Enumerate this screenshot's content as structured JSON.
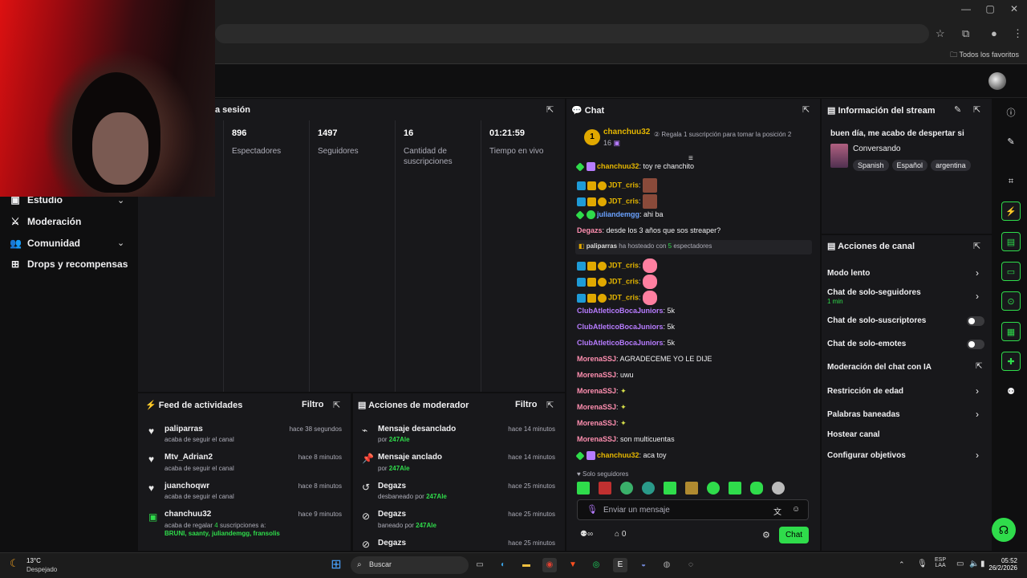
{
  "browser": {
    "bookmarks_label": "Todos los favoritos"
  },
  "leftnav": {
    "session_label": "a sesión",
    "items": [
      {
        "label": "Estudio",
        "icon": "video-icon",
        "has_chevron": true
      },
      {
        "label": "Moderación",
        "icon": "sword-icon",
        "has_chevron": false
      },
      {
        "label": "Comunidad",
        "icon": "people-icon",
        "has_chevron": true
      },
      {
        "label": "Drops y recompensas",
        "icon": "gift-icon",
        "has_chevron": false
      }
    ]
  },
  "stats": [
    {
      "value": "896",
      "label": "Espectadores"
    },
    {
      "value": "1497",
      "label": "Seguidores"
    },
    {
      "value": "16",
      "label": "Cantidad de suscripciones"
    },
    {
      "value": "01:21:59",
      "label": "Tiempo en vivo"
    }
  ],
  "feed": {
    "title": "Feed de actividades",
    "filter": "Filtro",
    "rows": [
      {
        "name": "paliparras",
        "sub": "acaba de seguir el canal",
        "time": "hace 38 segundos"
      },
      {
        "name": "Mtv_Adrian2",
        "sub": "acaba de seguir el canal",
        "time": "hace 8 minutos"
      },
      {
        "name": "juanchoqwr",
        "sub": "acaba de seguir el canal",
        "time": "hace 8 minutos"
      },
      {
        "name": "chanchuu32",
        "sub_a": "acaba de regalar ",
        "sub_n": "4",
        "sub_b": " suscripciones a:",
        "sub_list": "BRUNI, saanty, juliandemgg, fransolis",
        "time": "hace 9 minutos"
      }
    ]
  },
  "modact": {
    "title": "Acciones de moderador",
    "filter": "Filtro",
    "rows": [
      {
        "name": "Mensaje desanclado",
        "pre": "por ",
        "by": "247Ale",
        "time": "hace 14 minutos"
      },
      {
        "name": "Mensaje anclado",
        "pre": "por ",
        "by": "247Ale",
        "time": "hace 14 minutos"
      },
      {
        "name": "Degazs",
        "pre": "desbaneado por ",
        "by": "247Ale",
        "time": "hace 25 minutos"
      },
      {
        "name": "Degazs",
        "pre": "baneado por ",
        "by": "247Ale",
        "time": "hace 25 minutos"
      },
      {
        "name": "Degazs",
        "pre": "",
        "by": "",
        "time": "hace 25 minutos"
      }
    ]
  },
  "chat": {
    "title": "Chat",
    "top_gifter": {
      "rank": "1",
      "name": "chanchuu32",
      "count": "16"
    },
    "gift_prompt": "Regala 1 suscripción para tomar la posición 2",
    "messages": [
      {
        "user": "chanchuu32",
        "text": ": toy re chanchito"
      },
      {
        "user": "JDT_cris",
        "text": ":"
      },
      {
        "user": "JDT_cris",
        "text": ":"
      },
      {
        "user": "juliandemgg",
        "text": ": ahi ba"
      },
      {
        "user": "Degazs",
        "text": ": desde los 3 años que sos streaper?"
      },
      {
        "user": "JDT_cris",
        "text": ":"
      },
      {
        "user": "JDT_cris",
        "text": ":"
      },
      {
        "user": "JDT_cris",
        "text": ":"
      },
      {
        "user": "ClubAtleticoBocaJuniors",
        "text": ": 5k"
      },
      {
        "user": "ClubAtleticoBocaJuniors",
        "text": ": 5k"
      },
      {
        "user": "ClubAtleticoBocaJuniors",
        "text": ": 5k"
      },
      {
        "user": "MorenaSSJ",
        "text": ": AGRADECEME YO LE DIJE"
      },
      {
        "user": "MorenaSSJ",
        "text": ": uwu"
      },
      {
        "user": "MorenaSSJ",
        "text": ":"
      },
      {
        "user": "MorenaSSJ",
        "text": ":"
      },
      {
        "user": "MorenaSSJ",
        "text": ":"
      },
      {
        "user": "MorenaSSJ",
        "text": ": son multicuentas"
      },
      {
        "user": "chanchuu32",
        "text": ": aca toy"
      }
    ],
    "host_notice": {
      "user": "paliparras",
      "mid": " ha hosteado con ",
      "count": "5",
      "end": " espectadores"
    },
    "mode_label": "Solo seguidores",
    "input_placeholder": "Enviar un mensaje",
    "points": "0",
    "send_label": "Chat"
  },
  "info": {
    "title": "Información del stream",
    "stream_title": "buen día, me acabo de despertar si",
    "category": "Conversando",
    "tags": [
      "Spanish",
      "Español",
      "argentina"
    ]
  },
  "actions": {
    "title": "Acciones de canal",
    "items": [
      {
        "label": "Modo lento",
        "type": "chevron"
      },
      {
        "label": "Chat de solo-seguidores",
        "type": "chevron",
        "sub": "1 min"
      },
      {
        "label": "Chat de solo-suscriptores",
        "type": "toggle"
      },
      {
        "label": "Chat de solo-emotes",
        "type": "toggle"
      },
      {
        "label": "Moderación del chat con IA",
        "type": "external"
      },
      {
        "label": "Restricción de edad",
        "type": "chevron"
      },
      {
        "label": "Palabras baneadas",
        "type": "chevron"
      },
      {
        "label": "Hostear canal",
        "type": "none"
      },
      {
        "label": "Configurar objetivos",
        "type": "chevron"
      }
    ]
  },
  "taskbar": {
    "weather_temp": "13°C",
    "weather_desc": "Despejado",
    "search": "Buscar",
    "lang_top": "ESP",
    "lang_bottom": "LAA",
    "time": "05:52",
    "date": "26/2/2026"
  },
  "colors": {
    "accent": "#2fdc4b",
    "panel": "#18181b",
    "bg": "#0f0f10"
  }
}
